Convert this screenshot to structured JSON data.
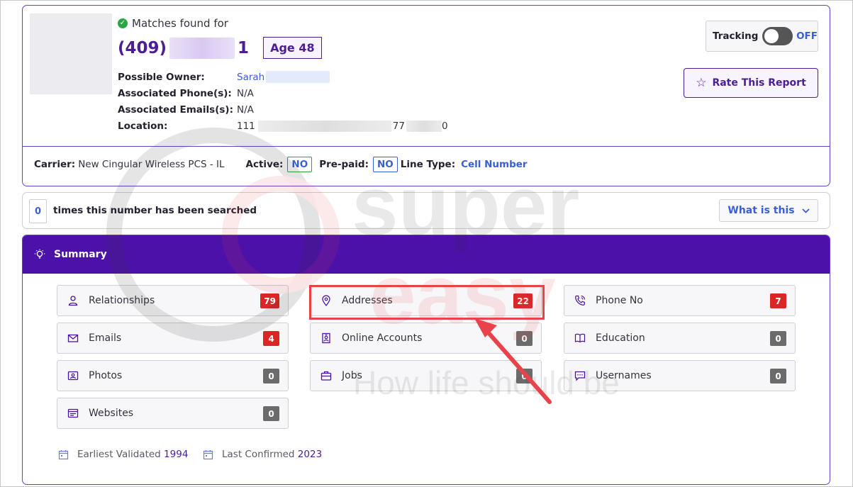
{
  "report": {
    "matches_label": "Matches found for",
    "phone_prefix": "(409)",
    "phone_suffix": "1",
    "age_badge": "Age 48",
    "info": [
      {
        "label": "Possible Owner:",
        "value": "Sarah"
      },
      {
        "label": "Associated Phone(s):",
        "value": "N/A"
      },
      {
        "label": "Associated Emails(s):",
        "value": "N/A"
      },
      {
        "label": "Location:",
        "value_start": "111",
        "value_mid": "77",
        "value_end": "0"
      }
    ],
    "tracking_label": "Tracking",
    "tracking_state": "OFF",
    "rate_button": "Rate This Report",
    "carrier_label": "Carrier:",
    "carrier_value": "New Cingular Wireless PCS - IL",
    "active_label": "Active:",
    "active_value": "NO",
    "prepaid_label": "Pre-paid:",
    "prepaid_value": "NO",
    "line_type_label": "Line Type:",
    "line_type_value": "Cell Number"
  },
  "searched": {
    "count": "0",
    "text": "times this number has been searched",
    "what_button": "What is this"
  },
  "summary": {
    "title": "Summary",
    "tiles": [
      {
        "label": "Relationships",
        "count": "79",
        "status": "red",
        "icon": "person-icon"
      },
      {
        "label": "Addresses",
        "count": "22",
        "status": "red",
        "icon": "location-pin-icon"
      },
      {
        "label": "Phone No",
        "count": "7",
        "status": "red",
        "icon": "phone-icon"
      },
      {
        "label": "Emails",
        "count": "4",
        "status": "red",
        "icon": "envelope-icon"
      },
      {
        "label": "Online Accounts",
        "count": "0",
        "status": "grey",
        "icon": "id-badge-icon"
      },
      {
        "label": "Education",
        "count": "0",
        "status": "grey",
        "icon": "book-icon"
      },
      {
        "label": "Photos",
        "count": "0",
        "status": "grey",
        "icon": "photo-icon"
      },
      {
        "label": "Jobs",
        "count": "0",
        "status": "grey",
        "icon": "briefcase-icon"
      },
      {
        "label": "Usernames",
        "count": "0",
        "status": "grey",
        "icon": "chat-icon"
      },
      {
        "label": "Websites",
        "count": "0",
        "status": "grey",
        "icon": "browser-icon"
      }
    ],
    "earliest_label": "Earliest Validated",
    "earliest_year": "1994",
    "confirmed_label": "Last Confirmed",
    "confirmed_year": "2023"
  },
  "watermark": {
    "line1": "super",
    "line2": "easy",
    "tagline": "How life should be"
  },
  "colors": {
    "primary_purple": "#4c11a8",
    "accent_red": "#dc2626",
    "link_blue": "#3a5fd0",
    "success_green": "#28a745"
  }
}
